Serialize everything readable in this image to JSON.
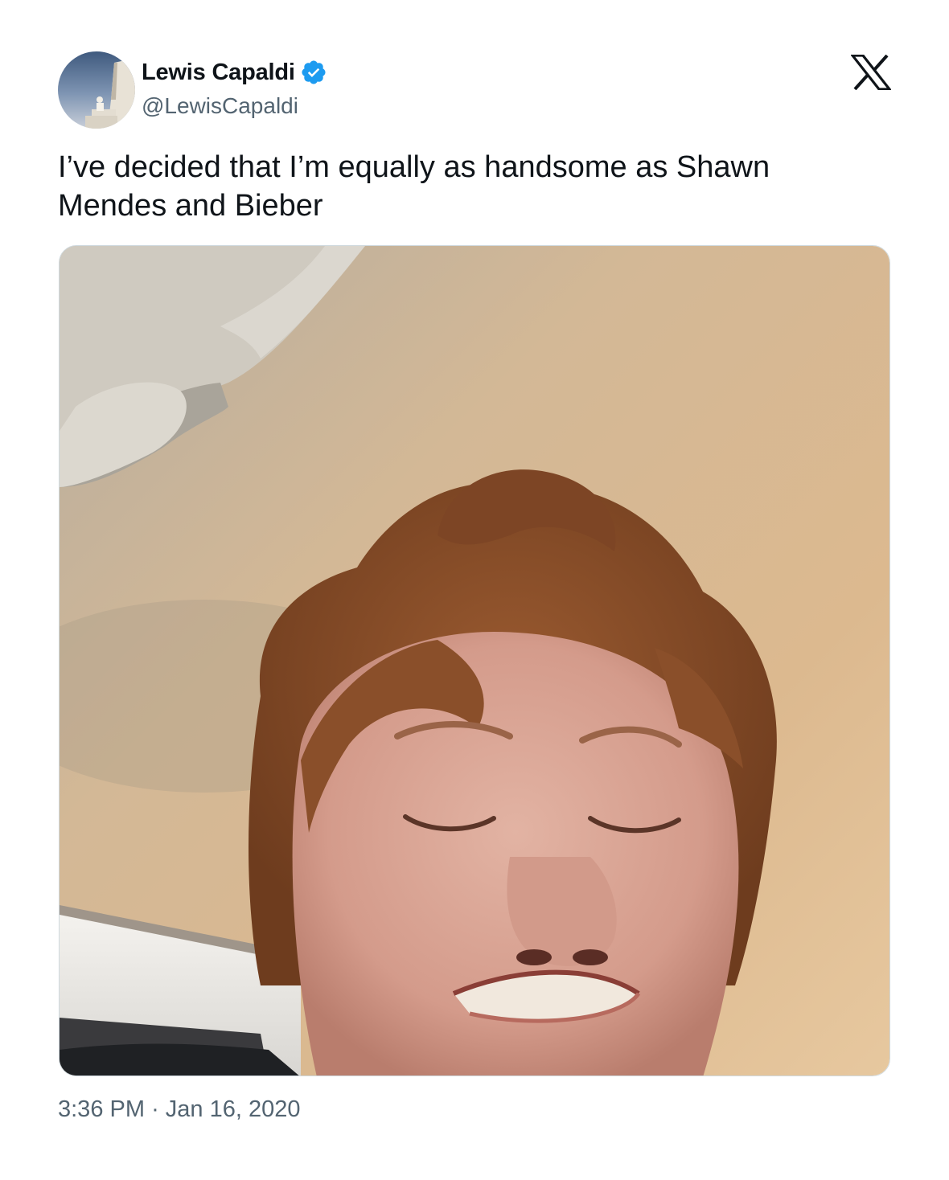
{
  "author": {
    "display_name": "Lewis Capaldi",
    "handle": "@LewisCapaldi",
    "verified": true,
    "verified_badge_color": "#1d9bf0"
  },
  "tweet": {
    "text": "I’ve decided that I’m equally as handsome as Shawn Mendes and Bieber",
    "time": "3:36 PM",
    "separator": "·",
    "date": "Jan 16, 2020"
  },
  "icons": {
    "platform_logo": "x-logo-icon",
    "verified": "verified-badge-icon"
  },
  "colors": {
    "text_primary": "#0f1419",
    "text_secondary": "#536471",
    "background": "#ffffff",
    "media_border": "#cfd9de"
  }
}
